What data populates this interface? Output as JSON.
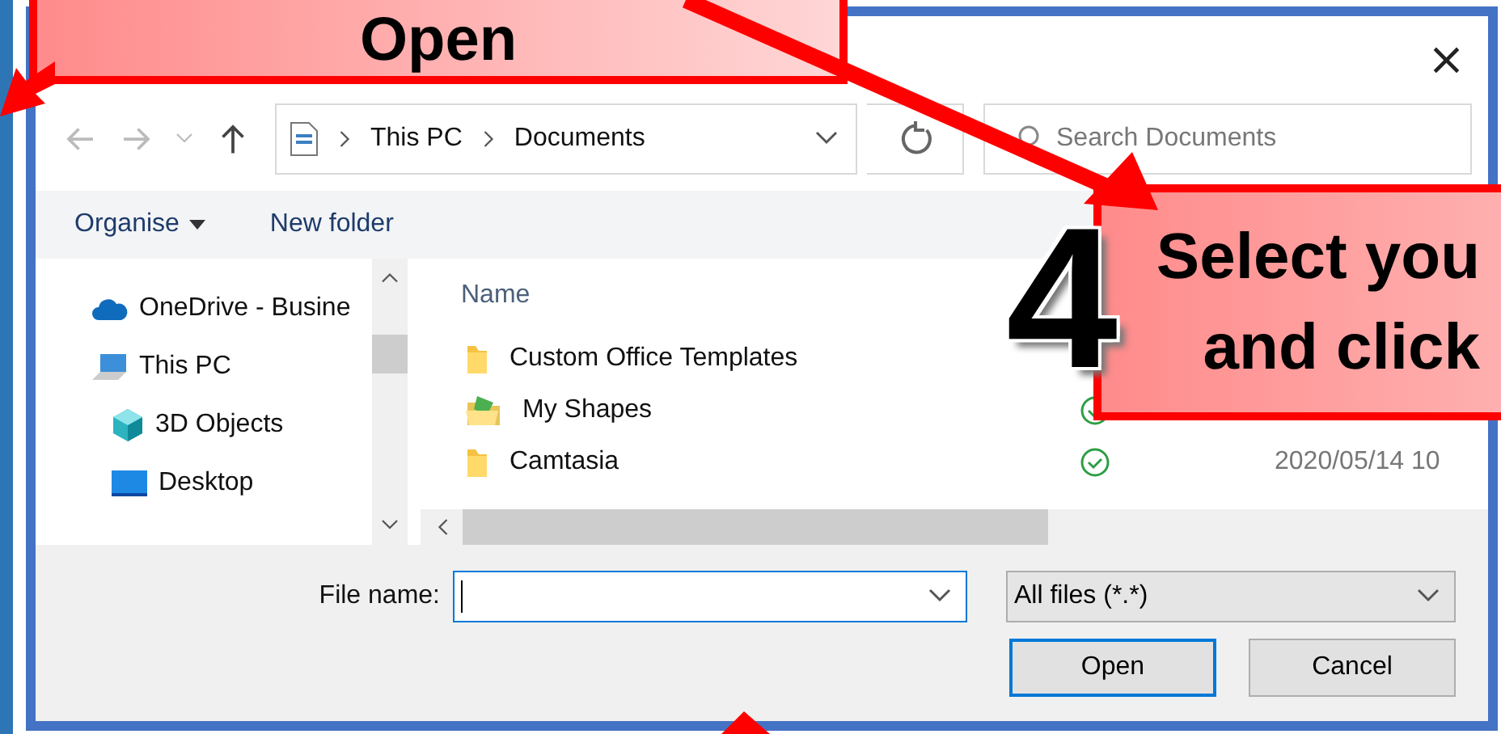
{
  "dialog": {
    "close": "×",
    "address": {
      "path": [
        "This PC",
        "Documents"
      ]
    },
    "search": {
      "placeholder": "Search Documents"
    },
    "toolbar": [
      {
        "label": "Organise",
        "dropdown": true
      },
      {
        "label": "New folder",
        "dropdown": false
      }
    ],
    "nav_pane": [
      {
        "kind": "cloud",
        "label": "OneDrive - Busine",
        "child": false
      },
      {
        "kind": "pc",
        "label": "This PC",
        "child": false
      },
      {
        "kind": "cube",
        "label": "3D Objects",
        "child": true
      },
      {
        "kind": "desktop",
        "label": "Desktop",
        "child": true
      }
    ],
    "file_list": {
      "columns": [
        "Name"
      ],
      "rows": [
        {
          "kind": "folder",
          "name": "Custom Office Templates"
        },
        {
          "kind": "shapes",
          "name": "My Shapes",
          "synced": true
        },
        {
          "kind": "folder",
          "name": "Camtasia",
          "synced": true,
          "date": "2020/05/14 10"
        }
      ]
    },
    "file_name": {
      "label": "File name:"
    },
    "filter": {
      "value": "All files (*.*)"
    },
    "buttons": [
      {
        "label": "Open",
        "default": true
      },
      {
        "label": "Cancel",
        "default": false
      }
    ]
  },
  "callouts": [
    {
      "kind": "top",
      "text": "Open"
    },
    {
      "kind": "step",
      "number": "4",
      "text": "Select you and click"
    }
  ]
}
